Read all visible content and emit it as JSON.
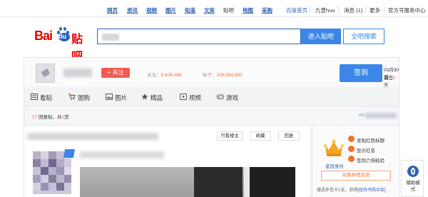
{
  "topnav": {
    "links": [
      "网页",
      "资讯",
      "视频",
      "图片",
      "知道",
      "文库",
      "贴吧",
      "地图",
      "采购"
    ],
    "baidu_home": "百度首页",
    "user": "九曾huu",
    "messages": "消息 (1)",
    "more": "更多",
    "official": "官方号服务中心"
  },
  "header": {
    "logo_bai": "Bai",
    "logo_du": "du",
    "logo_tieba": "贴吧",
    "search_value": "",
    "enter_button": "进入贴吧",
    "search_button": "全吧搜索"
  },
  "forum": {
    "follow_button": "+ 关注",
    "followers_label": "关注：",
    "followers_value": "5,604,088",
    "posts_label": "帖子：",
    "posts_value": "106,684,883",
    "sign_button": "签到",
    "sign_date": "03月30日",
    "sign_days_prefix": "漏签",
    "sign_days_value": "0",
    "sign_days_suffix": "天"
  },
  "tabs": [
    {
      "icon": "post-icon",
      "label": "看贴"
    },
    {
      "icon": "cart-icon",
      "label": "团购"
    },
    {
      "icon": "picture-icon",
      "label": "图片"
    },
    {
      "icon": "star-icon",
      "label": "精品"
    },
    {
      "icon": "video-icon",
      "label": "视频"
    },
    {
      "icon": "gamepad-icon",
      "label": "游戏"
    }
  ],
  "pager": {
    "reply_count": "27",
    "reply_label": "回复贴，共",
    "page_count": "1",
    "page_label": "页",
    "back_prefix": "<<"
  },
  "thread_controls": {
    "only_op": "只看楼主",
    "favorite": "收藏",
    "reply": "回复"
  },
  "sidebar": {
    "crown_label": "皇冠身份",
    "perks": [
      "发贴红色标题",
      "显示红名",
      "签到六倍经验"
    ],
    "member_button": "兑换本吧会员",
    "gift_prefix": "赠送补签卡1张，获得",
    "gift_link": "[经验书购买权]"
  },
  "assist": {
    "label": "辅助模式"
  },
  "colors": {
    "brand_blue": "#3b86e8",
    "link_blue": "#2d64b3",
    "orange": "#f27226",
    "red": "#e10602"
  }
}
